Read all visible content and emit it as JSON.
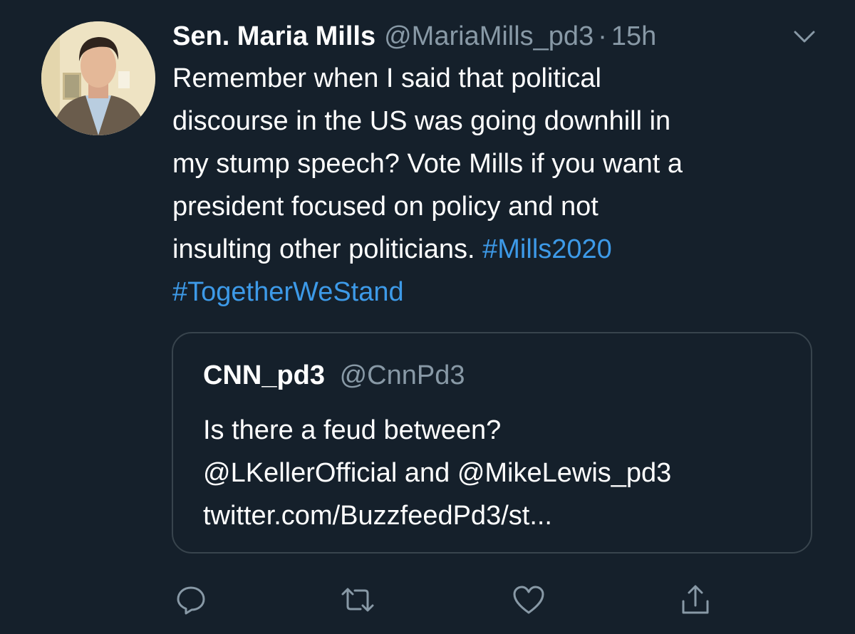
{
  "tweet": {
    "author": {
      "display_name": "Sen. Maria Mills",
      "handle": "@MariaMills_pd3",
      "separator": "·",
      "timestamp": "15h",
      "avatar_icon": "profile-photo"
    },
    "text_lines": [
      "Remember when I said that political",
      "discourse in the US was going downhill in",
      "my stump speech? Vote Mills if you want a",
      "president focused on policy and not"
    ],
    "text_last_line": "insulting other politicians.",
    "hashtags": [
      "#Mills2020",
      "#TogetherWeStand"
    ],
    "quoted_tweet": {
      "display_name": "CNN_pd3",
      "handle": "@CnnPd3",
      "text_lines": [
        "Is there a feud between?",
        "@LKellerOfficial and @MikeLewis_pd3",
        "twitter.com/BuzzfeedPd3/st..."
      ]
    },
    "actions": [
      {
        "name": "reply",
        "icon": "comment-icon"
      },
      {
        "name": "retweet",
        "icon": "retweet-icon"
      },
      {
        "name": "like",
        "icon": "heart-icon"
      },
      {
        "name": "share",
        "icon": "share-icon"
      }
    ]
  },
  "colors": {
    "background": "#15202b",
    "text": "#ffffff",
    "secondary_text": "#8899a6",
    "link": "#3d9ae8",
    "border": "#38444d"
  }
}
